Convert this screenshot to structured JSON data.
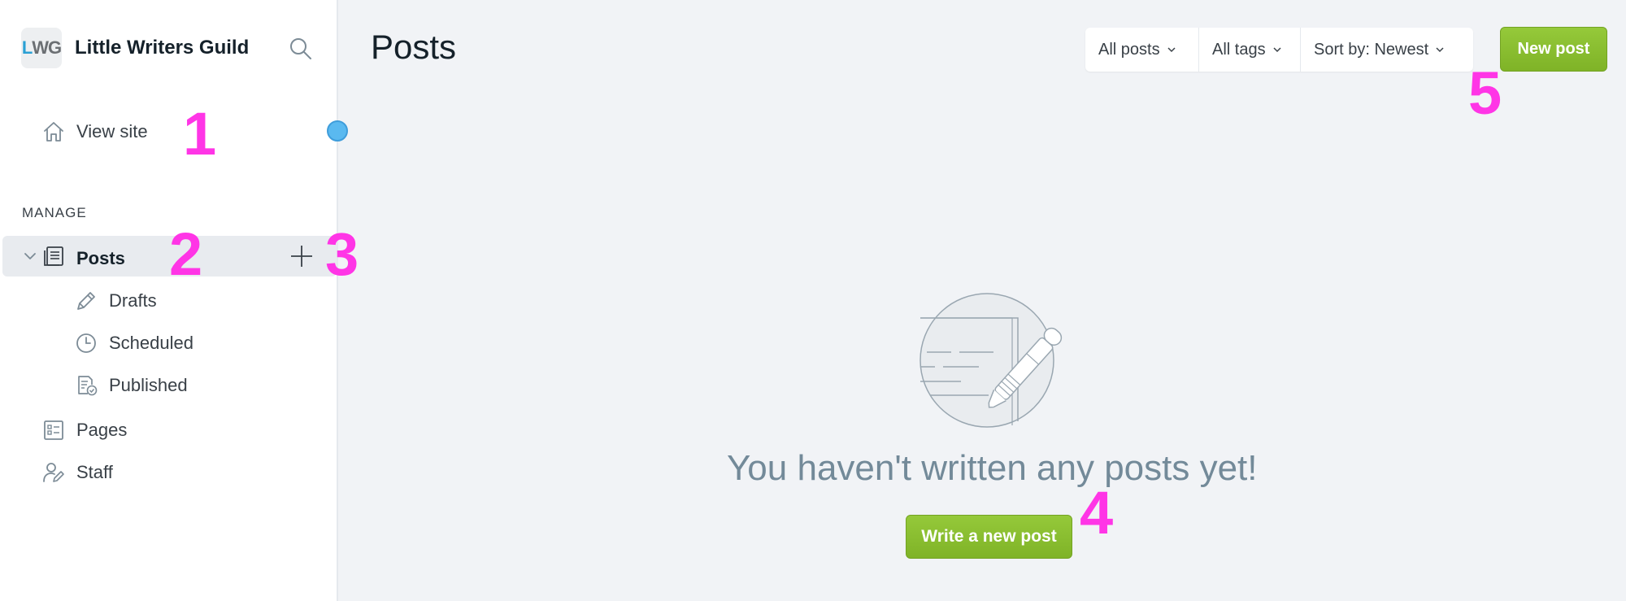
{
  "sidebar": {
    "logo_l": "L",
    "logo_wg": "WG",
    "site_title": "Little Writers Guild",
    "view_site": "View site",
    "section_label": "MANAGE",
    "posts": "Posts",
    "drafts": "Drafts",
    "scheduled": "Scheduled",
    "published": "Published",
    "pages": "Pages",
    "staff": "Staff"
  },
  "main": {
    "title": "Posts",
    "filters": [
      "All posts",
      "All tags",
      "Sort by: Newest"
    ],
    "new_post": "New post",
    "empty_message": "You haven't written any posts yet!",
    "write_button": "Write a new post"
  },
  "markers": [
    "1",
    "2",
    "3",
    "4",
    "5"
  ],
  "colors": {
    "accent_green": "#8bc034",
    "marker_magenta": "#ff35e6",
    "indicator_blue": "#5ab9f0"
  },
  "icons": [
    "search-icon",
    "home-icon",
    "chevron-down-icon",
    "posts-icon",
    "plus-icon",
    "pencil-icon",
    "clock-icon",
    "published-icon",
    "pages-icon",
    "staff-icon"
  ]
}
